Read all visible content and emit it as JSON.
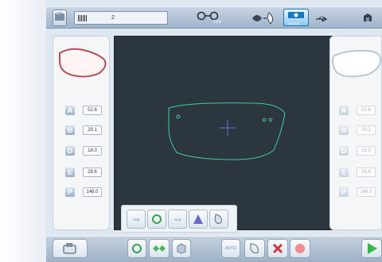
{
  "job": {
    "number": "2"
  },
  "topbar": {
    "bridge_value": "20.8",
    "mode_label": "eskOLE"
  },
  "parameters": [
    {
      "letter": "A",
      "left_value": "52.8",
      "right_value": "52.8"
    },
    {
      "letter": "B",
      "left_value": "29.1",
      "right_value": "29.1"
    },
    {
      "letter": "D",
      "left_value": "18.0",
      "right_value": "18.0"
    },
    {
      "letter": "E",
      "left_value": "28.6",
      "right_value": "28.6"
    },
    {
      "letter": "P",
      "left_value": "148.0",
      "right_value": "148.0"
    }
  ],
  "toolbar": {
    "small_left": "+3.5",
    "small_right": "+1.5"
  },
  "footer": {
    "disabled_label": "AUTO"
  }
}
